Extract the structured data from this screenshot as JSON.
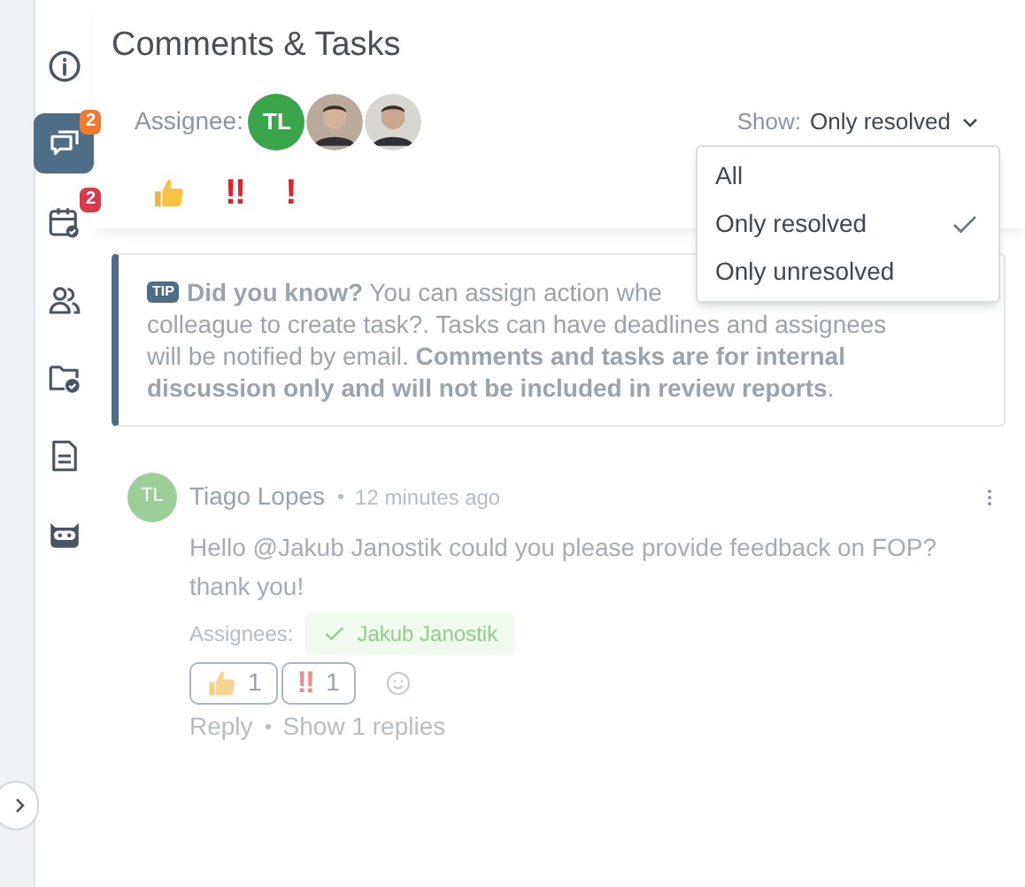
{
  "title": "Comments & Tasks",
  "sidebar": {
    "items": [
      {
        "kind": "info",
        "selected": false
      },
      {
        "kind": "comments",
        "selected": true,
        "badge": "2",
        "color": "#f07a2e"
      },
      {
        "kind": "tasks",
        "selected": false,
        "badge": "2",
        "color": "#d83a4a"
      },
      {
        "kind": "people",
        "selected": false
      },
      {
        "kind": "folder",
        "selected": false
      },
      {
        "kind": "document",
        "selected": false
      },
      {
        "kind": "robot",
        "selected": false
      }
    ]
  },
  "assignee_filter": {
    "label": "Assignee:",
    "avatars": [
      {
        "kind": "initials",
        "initials": "TL"
      },
      {
        "kind": "picture"
      },
      {
        "kind": "picture"
      }
    ]
  },
  "reaction_filter": [
    {
      "kind": "thumbs"
    },
    {
      "kind": "text",
      "text": "‼"
    },
    {
      "kind": "text",
      "text": "!"
    }
  ],
  "show_filter": {
    "label": "Show:",
    "value": "Only resolved",
    "expanded": true,
    "options": [
      {
        "label": "All",
        "selected": false
      },
      {
        "label": "Only resolved",
        "selected": true
      },
      {
        "label": "Only unresolved",
        "selected": false
      }
    ]
  },
  "tip": {
    "badge": "TIP",
    "lines": [
      "**Did you know?** You can assign action whe",
      "colleague to create task?. Tasks can have deadlines and assignees",
      "will be notified by email. **Comments and tasks are for internal**",
      "**discussion only and will not be included in review reports**."
    ]
  },
  "comments": [
    {
      "initials": "TL",
      "author": "Tiago Lopes",
      "time": "12 minutes ago",
      "text": "Hello @Jakub Janostik could you please provide feedback on FOP? thank you!",
      "assignees_label": "Assignees:",
      "assignees": [
        {
          "name": "Jakub Janostik",
          "done": true
        }
      ],
      "reactions": [
        {
          "kind": "thumbs",
          "count": "1"
        },
        {
          "kind": "text",
          "text": "‼",
          "count": "1"
        }
      ],
      "actions": [
        "Reply",
        "Show 1 replies"
      ]
    }
  ]
}
